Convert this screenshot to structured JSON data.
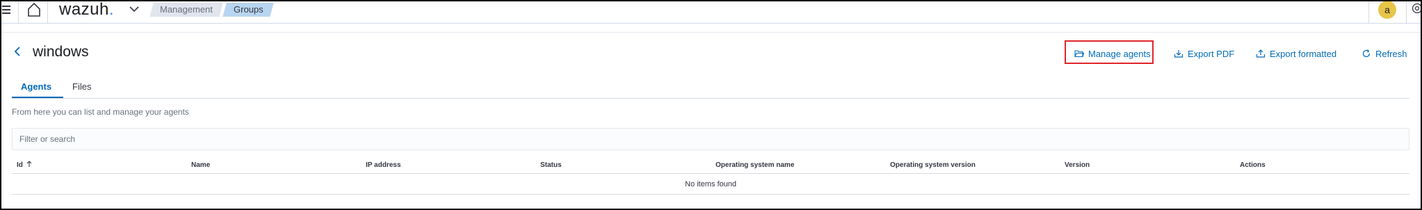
{
  "header": {
    "logo_text": "wazuh",
    "logo_dot": ".",
    "breadcrumbs": [
      {
        "label": "Management"
      },
      {
        "label": "Groups"
      }
    ],
    "user_initial": "a"
  },
  "page": {
    "title": "windows",
    "actions": [
      {
        "label": "Manage agents",
        "icon": "folder-open-icon"
      },
      {
        "label": "Export PDF",
        "icon": "download-icon"
      },
      {
        "label": "Export formatted",
        "icon": "upload-icon"
      },
      {
        "label": "Refresh",
        "icon": "refresh-icon"
      }
    ],
    "tabs": [
      {
        "label": "Agents",
        "active": true
      },
      {
        "label": "Files",
        "active": false
      }
    ],
    "description": "From here you can list and manage your agents",
    "search_placeholder": "Filter or search"
  },
  "table": {
    "columns": [
      "Id",
      "Name",
      "IP address",
      "Status",
      "Operating system name",
      "Operating system version",
      "Version",
      "Actions"
    ],
    "sort_column": "Id",
    "sort_direction": "ascending",
    "empty_message": "No items found"
  },
  "colors": {
    "accent": "#006bb8",
    "highlight": "#e0262b",
    "avatar": "#e7c548"
  }
}
